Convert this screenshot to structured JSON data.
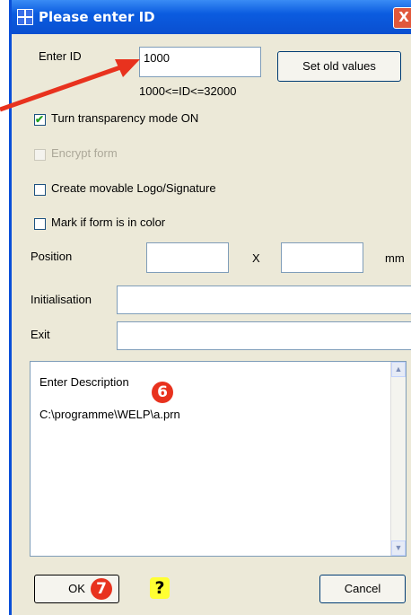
{
  "window": {
    "title": "Please enter ID",
    "close_glyph": "X"
  },
  "id_field": {
    "label": "Enter ID",
    "value": "1000",
    "range_hint": "1000<=ID<=32000"
  },
  "set_old_values_label": "Set old values",
  "checkboxes": [
    {
      "label": "Turn transparency mode ON",
      "checked": true,
      "enabled": true
    },
    {
      "label": "Encrypt form",
      "checked": false,
      "enabled": false
    },
    {
      "label": "Create movable Logo/Signature",
      "checked": false,
      "enabled": true
    },
    {
      "label": "Mark if form is in color",
      "checked": false,
      "enabled": true
    }
  ],
  "position": {
    "label": "Position",
    "x_value": "",
    "separator": "X",
    "y_value": "",
    "unit": "mm"
  },
  "initialisation": {
    "label": "Initialisation",
    "value": ""
  },
  "exit": {
    "label": "Exit",
    "value": ""
  },
  "description": {
    "text": "Enter Description\n\nC:\\programme\\WELP\\a.prn"
  },
  "ok_label": "OK",
  "cancel_label": "Cancel",
  "annotations": {
    "badge_6": "6",
    "badge_7": "7",
    "help": "?"
  },
  "colors": {
    "title_bar": "#0b5ce0",
    "dialog_bg": "#ece9d8",
    "arrow": "#e8321e",
    "help_bg": "#ffff33"
  },
  "icons": [
    "app-icon",
    "close-icon",
    "check-icon",
    "scroll-up-icon",
    "scroll-down-icon",
    "arrow-annotation"
  ]
}
